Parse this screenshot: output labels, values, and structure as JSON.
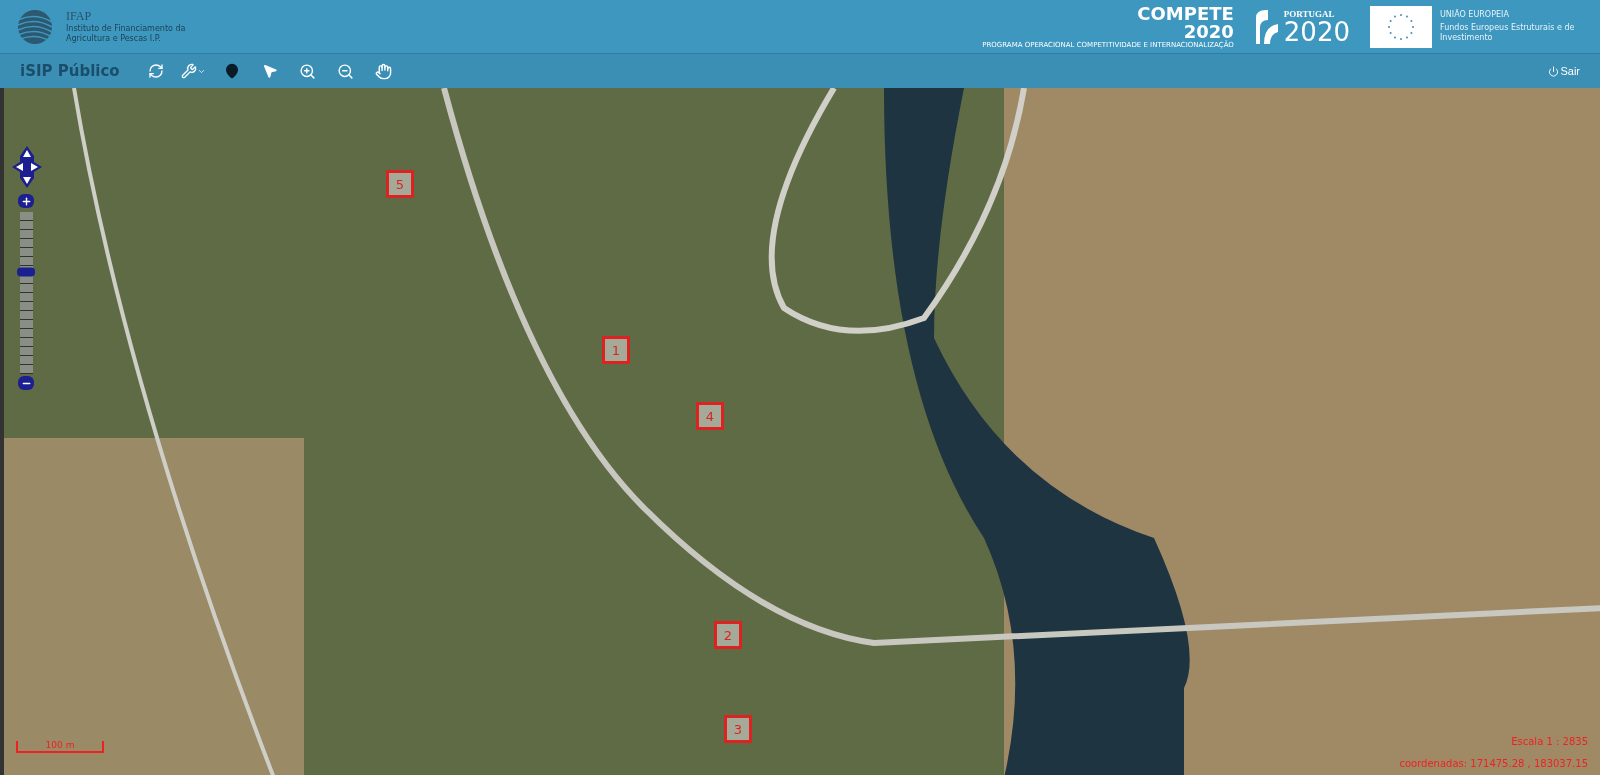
{
  "header": {
    "org": {
      "name": "IFAP",
      "subtitle": "Instituto de Financiamento da Agricultura e Pescas I.P."
    },
    "compete": {
      "title": "COMPETE",
      "year": "2020",
      "caption": "PROGRAMA OPERACIONAL COMPETITIVIDADE E INTERNACIONALIZAÇÃO"
    },
    "portugal": {
      "title": "PORTUGAL",
      "year": "2020"
    },
    "eu": {
      "title": "UNIÃO EUROPEIA",
      "caption": "Fundos Europeus Estruturais e de Investimento"
    }
  },
  "toolbar": {
    "app_title": "iSIP Público",
    "tools": [
      {
        "kind": "refresh",
        "selected": false
      },
      {
        "kind": "wrench",
        "selected": false
      },
      {
        "kind": "pin",
        "selected": true
      },
      {
        "kind": "pointer",
        "selected": false
      },
      {
        "kind": "zoom-in",
        "selected": false
      },
      {
        "kind": "zoom-out",
        "selected": false
      },
      {
        "kind": "pan",
        "selected": false
      }
    ],
    "logout": "Sair"
  },
  "map": {
    "zoom": {
      "level": 0.63
    },
    "markers": [
      {
        "label": "5"
      },
      {
        "label": "1"
      },
      {
        "label": "4"
      },
      {
        "label": "2"
      },
      {
        "label": "3"
      }
    ],
    "scale_bar": "100 m",
    "scale": "Escala 1 : 2835",
    "coordinates": "coordenadas: 171475.28 , 183037.15"
  }
}
